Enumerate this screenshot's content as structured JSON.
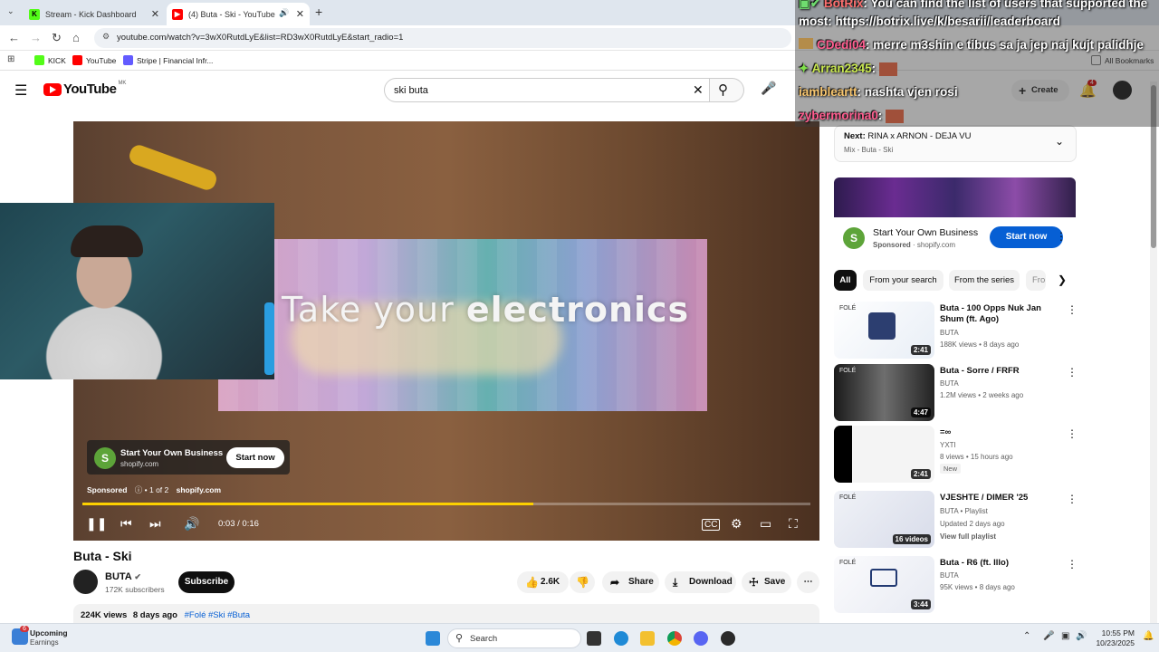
{
  "browser": {
    "tabs": [
      {
        "label": "Stream - Kick Dashboard",
        "color": "#53fc18"
      },
      {
        "label": "(4) Buta - Ski - YouTube",
        "color": "#ff0000"
      }
    ],
    "url": "youtube.com/watch?v=3wX0RutdLyE&list=RD3wX0RutdLyE&start_radio=1",
    "bookmarks": [
      "KICK",
      "YouTube",
      "Stripe | Financial Infr..."
    ],
    "all_bookmarks": "All Bookmarks"
  },
  "header": {
    "logo_text": "YouTube",
    "country_code": "MK",
    "search_value": "ski buta",
    "create_label": "Create",
    "notif_count": "4"
  },
  "player": {
    "overlay_text_a": "Take your ",
    "overlay_text_b": "electronics",
    "ad_title": "Start Your Own Business",
    "ad_domain": "shopify.com",
    "ad_button": "Start now",
    "sponsored": "Sponsored",
    "sponsored_count": "ⓘ • 1 of 2",
    "sponsored_domain": "shopify.com",
    "time": "0:03 / 0:16",
    "progress": 0.62
  },
  "video": {
    "title": "Buta - Ski",
    "channel": "BUTA",
    "subs": "172K subscribers",
    "subscribe": "Subscribe",
    "likes": "2.6K",
    "share": "Share",
    "download": "Download",
    "save": "Save",
    "views": "224K views",
    "age": "8 days ago",
    "tags": "#Folé #Ski #Buta"
  },
  "sidebar": {
    "next_label": "Next:",
    "next_title": "RINA x ARNON - DEJA VU",
    "next_sub": "Mix - Buta - Ski",
    "ad_title": "Start Your Own Business",
    "ad_sponsored": "Sponsored",
    "ad_domain": "shopify.com",
    "ad_button": "Start now",
    "chips": [
      "All",
      "From your search",
      "From the series",
      "Fro"
    ],
    "videos": [
      {
        "title": "Buta - 100 Opps Nuk Jan Shum (ft. Ago)",
        "channel": "BUTA",
        "meta": "188K views • 8 days ago",
        "duration": "2:41"
      },
      {
        "title": "Buta - Sorre / FRFR",
        "channel": "BUTA",
        "meta": "1.2M views • 2 weeks ago",
        "duration": "4:47"
      },
      {
        "title": "=∞",
        "channel": "YXTI",
        "meta": "8 views • 15 hours ago",
        "badge": "New",
        "duration": "2:41"
      },
      {
        "title": "VJESHTE / DIMER '25",
        "channel": "BUTA • Playlist",
        "meta": "Updated 2 days ago",
        "extra": "View full playlist",
        "duration": "16 videos"
      },
      {
        "title": "Buta - R6 (ft. Illo)",
        "channel": "BUTA",
        "meta": "95K views • 8 days ago",
        "duration": "3:44"
      }
    ]
  },
  "chat": {
    "lines": [
      {
        "name": "BotRix",
        "text": ": You can find the list of users that supported the"
      },
      {
        "name": "",
        "text": "most: https://botrix.live/k/besarii/leaderboard"
      },
      {
        "name": "CDedi04",
        "text": ": merre m3shin e tibus sa ja jep naj kujt palidhje"
      },
      {
        "name": "Arran2345",
        "text": ":"
      },
      {
        "name": "iambleartt",
        "text": ": nashta vjen rosi"
      },
      {
        "name": "zybermorina0",
        "text": ":"
      }
    ]
  },
  "taskbar": {
    "weather_title": "Upcoming",
    "weather_sub": "Earnings",
    "search": "Search",
    "time": "10:55 PM",
    "date": "10/23/2025",
    "badge": "6"
  }
}
